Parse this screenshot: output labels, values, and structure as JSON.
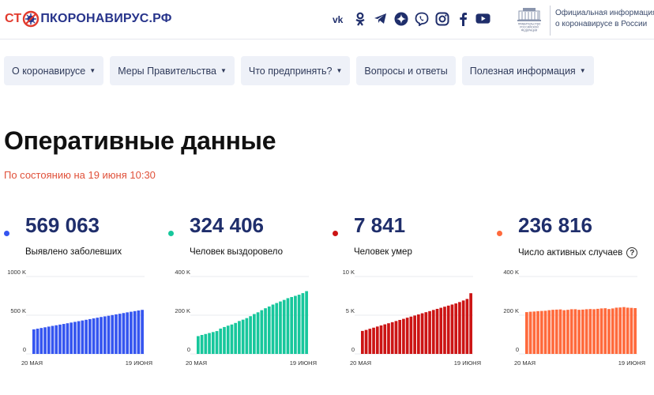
{
  "header": {
    "logo": {
      "part1": "СТ",
      "part2": "ПКОРОНАВИРУС.РФ"
    },
    "social": [
      {
        "icon": "vk-icon",
        "glyph": "vk"
      },
      {
        "icon": "odnoklassniki-icon",
        "glyph": "ok"
      },
      {
        "icon": "telegram-icon",
        "glyph": "tg"
      },
      {
        "icon": "yandex-zen-icon",
        "glyph": "zen"
      },
      {
        "icon": "viber-icon",
        "glyph": "viber"
      },
      {
        "icon": "instagram-icon",
        "glyph": "ig"
      },
      {
        "icon": "facebook-icon",
        "glyph": "f"
      },
      {
        "icon": "youtube-icon",
        "glyph": "yt"
      }
    ],
    "gov_emblem_text": "ПРАВИТЕЛЬСТВО РОССИЙСКОЙ ФЕДЕРАЦИИ",
    "gov_line1": "Официальная информация",
    "gov_line2": "о коронавирусе в России"
  },
  "nav": [
    {
      "label": "О коронавирусе",
      "dropdown": true
    },
    {
      "label": "Меры Правительства",
      "dropdown": true
    },
    {
      "label": "Что предпринять?",
      "dropdown": true
    },
    {
      "label": "Вопросы и ответы",
      "dropdown": false
    },
    {
      "label": "Полезная информация",
      "dropdown": true
    }
  ],
  "page": {
    "title": "Оперативные данные",
    "as_of": "По состоянию на 19 июня 10:30"
  },
  "colors": {
    "accent_red": "#e0513a",
    "navy": "#1f2e6b",
    "cases": "#3555f0",
    "recovered": "#17c79c",
    "deaths": "#cc1414",
    "active": "#ff6a3c"
  },
  "stats": [
    {
      "value": "569 063",
      "label": "Выявлено заболевших",
      "color": "#3555f0"
    },
    {
      "value": "324 406",
      "label": "Человек выздоровело",
      "color": "#17c79c"
    },
    {
      "value": "7 841",
      "label": "Человек умер",
      "color": "#cc1414"
    },
    {
      "value": "236 816",
      "label": "Число активных случаев",
      "color": "#ff6a3c",
      "help": "?"
    }
  ],
  "chart_data": [
    {
      "type": "bar",
      "x_start": "20 МАЯ",
      "x_end": "19 ИЮНЯ",
      "ylim": [
        0,
        1000000
      ],
      "y_ticks": [
        {
          "value": 0,
          "label": "0"
        },
        {
          "value": 500000,
          "label": "500 K"
        },
        {
          "value": 1000000,
          "label": "1000 K"
        }
      ],
      "values": [
        317000,
        326000,
        335000,
        344000,
        353000,
        362000,
        370000,
        379000,
        387000,
        396000,
        405000,
        414000,
        423000,
        432000,
        441000,
        450000,
        459000,
        468000,
        477000,
        485000,
        493000,
        502000,
        511000,
        519000,
        528000,
        537000,
        545000,
        553000,
        561000,
        569063
      ]
    },
    {
      "type": "bar",
      "x_start": "20 МАЯ",
      "x_end": "19 ИЮНЯ",
      "ylim": [
        0,
        400000
      ],
      "y_ticks": [
        {
          "value": 0,
          "label": "0"
        },
        {
          "value": 200000,
          "label": "200 K"
        },
        {
          "value": 400000,
          "label": "400 K"
        }
      ],
      "values": [
        92000,
        98000,
        103000,
        108000,
        113000,
        118000,
        131000,
        139000,
        146000,
        152000,
        160000,
        170000,
        177000,
        185000,
        195000,
        206000,
        215000,
        226000,
        236000,
        245000,
        255000,
        263000,
        271000,
        279000,
        288000,
        294000,
        300000,
        306000,
        314000,
        324406
      ]
    },
    {
      "type": "bar",
      "x_start": "20 МАЯ",
      "x_end": "19 ИЮНЯ",
      "ylim": [
        0,
        10000
      ],
      "y_ticks": [
        {
          "value": 0,
          "label": "0"
        },
        {
          "value": 5000,
          "label": "5 K"
        },
        {
          "value": 10000,
          "label": "10 K"
        }
      ],
      "values": [
        2970,
        3100,
        3250,
        3390,
        3540,
        3680,
        3820,
        3960,
        4100,
        4250,
        4390,
        4530,
        4680,
        4820,
        4960,
        5100,
        5250,
        5390,
        5530,
        5680,
        5820,
        5960,
        6100,
        6240,
        6380,
        6520,
        6700,
        6900,
        7100,
        7841
      ]
    },
    {
      "type": "bar",
      "x_start": "20 МАЯ",
      "x_end": "19 ИЮНЯ",
      "ylim": [
        0,
        400000
      ],
      "y_ticks": [
        {
          "value": 0,
          "label": "0"
        },
        {
          "value": 200000,
          "label": "200 K"
        },
        {
          "value": 400000,
          "label": "400 K"
        }
      ],
      "values": [
        216000,
        218000,
        219000,
        221000,
        222000,
        223000,
        226000,
        228000,
        229000,
        230000,
        226000,
        228000,
        231000,
        231000,
        228000,
        229000,
        231000,
        232000,
        231000,
        233000,
        235000,
        236000,
        232000,
        235000,
        239000,
        240000,
        242000,
        239000,
        238000,
        236816
      ]
    }
  ]
}
